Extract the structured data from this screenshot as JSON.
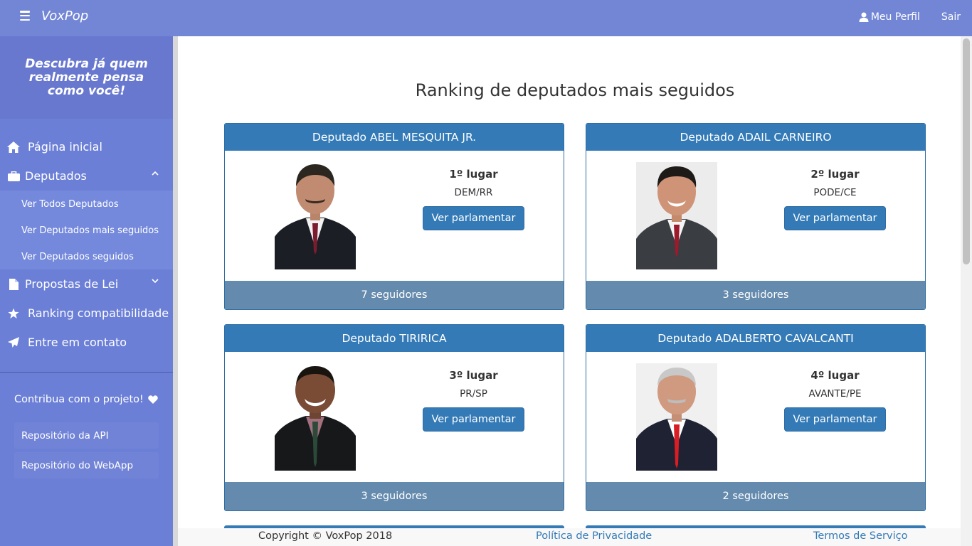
{
  "app": {
    "brand": "VoxPop"
  },
  "topbar": {
    "profile_label": "Meu Perfil",
    "logout_label": "Sair"
  },
  "sidebar": {
    "tagline": "Descubra já quem realmente pensa como você!",
    "home": "Página inicial",
    "deputados": "Deputados",
    "submenu": [
      "Ver Todos Deputados",
      "Ver Deputados mais seguidos",
      "Ver Deputados seguidos"
    ],
    "propostas": "Propostas de Lei",
    "ranking": "Ranking compatibilidade",
    "contato": "Entre em contato",
    "contribute": "Contribua com o projeto!",
    "repo_api": "Repositório da API",
    "repo_webapp": "Repositório do WebApp"
  },
  "main": {
    "title": "Ranking de deputados mais seguidos",
    "cards": [
      {
        "name": "Deputado ABEL MESQUITA JR.",
        "rank": "1º lugar",
        "party": "DEM/RR",
        "button": "Ver parlamentar",
        "followers": "7 seguidores"
      },
      {
        "name": "Deputado ADAIL CARNEIRO",
        "rank": "2º lugar",
        "party": "PODE/CE",
        "button": "Ver parlamentar",
        "followers": "3 seguidores"
      },
      {
        "name": "Deputado TIRIRICA",
        "rank": "3º lugar",
        "party": "PR/SP",
        "button": "Ver parlamentar",
        "followers": "3 seguidores"
      },
      {
        "name": "Deputado ADALBERTO CAVALCANTI",
        "rank": "4º lugar",
        "party": "AVANTE/PE",
        "button": "Ver parlamentar",
        "followers": "2 seguidores"
      }
    ]
  },
  "footer": {
    "copyright": "Copyright © VoxPop 2018",
    "privacy": "Política de Privacidade",
    "terms": "Termos de Serviço"
  },
  "colors": {
    "navbar": "#7286d5",
    "sidebar": "#6b7fd7",
    "primary": "#337ab7",
    "card_footer": "#648aad"
  },
  "icons": [
    "menu-icon",
    "user-icon",
    "home-icon",
    "briefcase-icon",
    "chevron-up-icon",
    "chevron-down-icon",
    "file-icon",
    "star-icon",
    "send-icon",
    "heart-icon"
  ]
}
